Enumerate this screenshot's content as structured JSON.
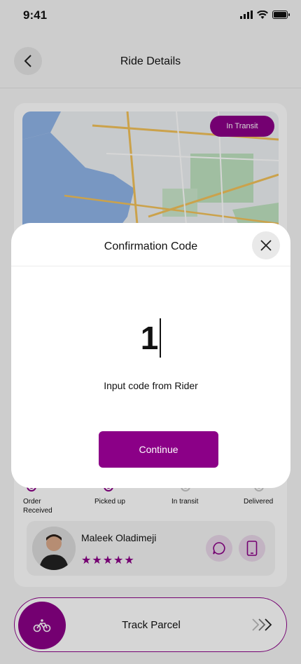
{
  "status_bar": {
    "time": "9:41"
  },
  "header": {
    "title": "Ride Details"
  },
  "map": {
    "status_pill": "In Transit"
  },
  "steps": [
    {
      "label": "Order\nReceived",
      "active": true
    },
    {
      "label": "Picked up",
      "active": true
    },
    {
      "label": "In transit",
      "active": false
    },
    {
      "label": "Delivered",
      "active": false
    }
  ],
  "rider": {
    "name": "Maleek Oladimeji",
    "rating": 5,
    "stars": "★★★★★"
  },
  "track": {
    "label": "Track Parcel"
  },
  "modal": {
    "title": "Confirmation Code",
    "code_value": "1",
    "hint": "Input code from Rider",
    "continue_label": "Continue"
  },
  "colors": {
    "accent": "#8b0087",
    "background": "#f5f5f5"
  },
  "icons": [
    "back-arrow-icon",
    "close-icon",
    "chat-icon",
    "phone-icon",
    "bicycle-icon",
    "chevrons-right-icon"
  ]
}
